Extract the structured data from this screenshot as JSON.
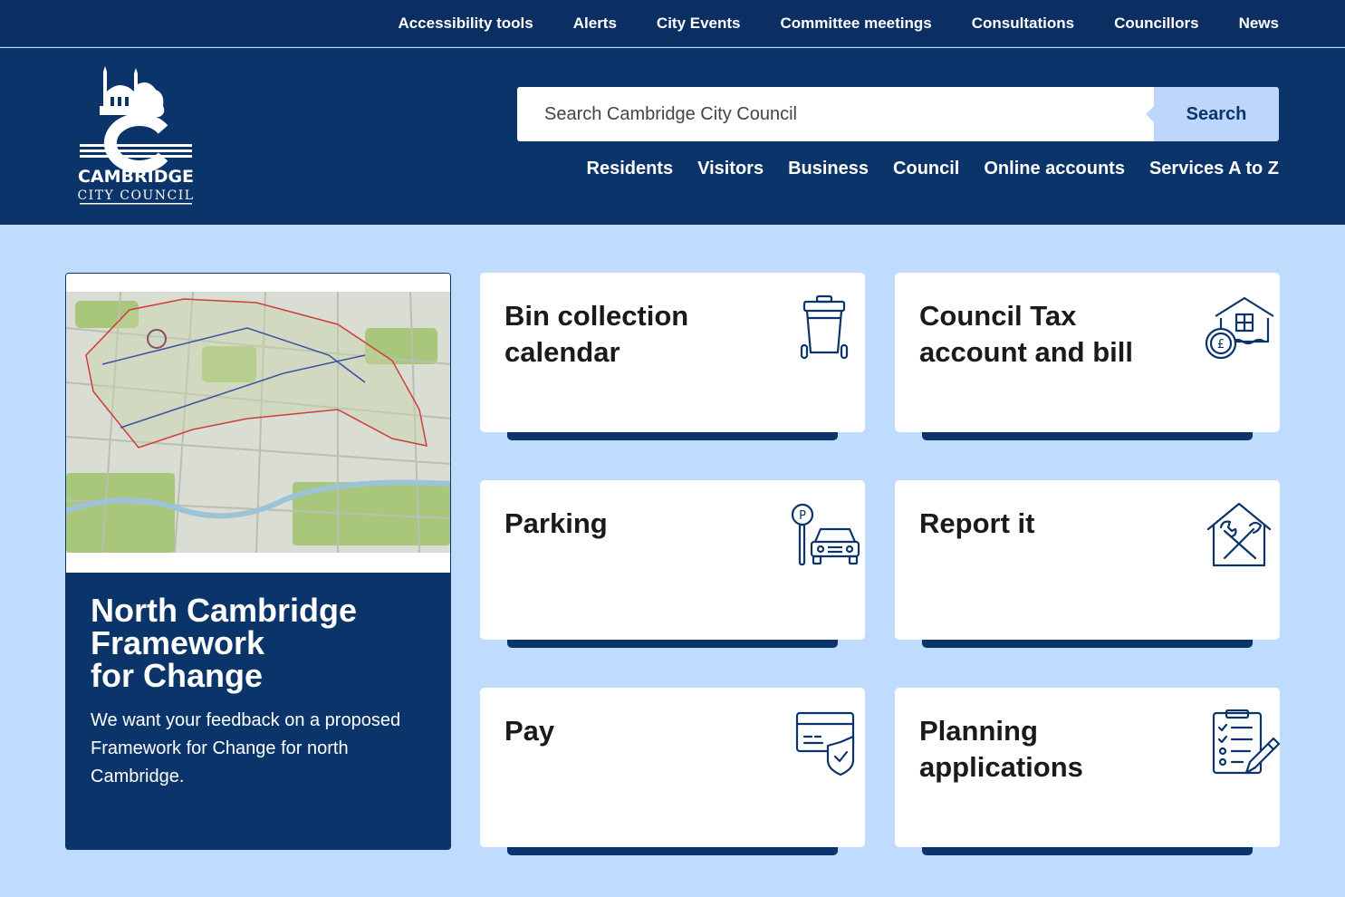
{
  "top_links": [
    "Accessibility tools",
    "Alerts",
    "City Events",
    "Committee meetings",
    "Consultations",
    "Councillors",
    "News"
  ],
  "logo": {
    "line1": "CAMBRIDGE",
    "line2": "CITY COUNCIL"
  },
  "search": {
    "placeholder": "Search Cambridge City Council",
    "button_label": "Search"
  },
  "main_nav": [
    "Residents",
    "Visitors",
    "Business",
    "Council",
    "Online accounts",
    "Services A to Z"
  ],
  "feature": {
    "title_lines": [
      "North Cambridge",
      "Framework",
      "for Change"
    ],
    "description": "We want your feedback on a proposed Framework for Change for north Cambridge."
  },
  "tiles": [
    {
      "title": "Bin collection calendar",
      "icon": "wheelie-bin-icon"
    },
    {
      "title": "Council Tax account and bill",
      "icon": "house-pound-icon"
    },
    {
      "title": "Parking",
      "icon": "parking-car-icon"
    },
    {
      "title": "Report it",
      "icon": "house-tools-icon"
    },
    {
      "title": "Pay",
      "icon": "card-shield-icon"
    },
    {
      "title": "Planning applications",
      "icon": "checklist-pencil-icon"
    }
  ],
  "colors": {
    "navy": "#0a346a",
    "top_bar": "#0b2e63",
    "page_bg": "#bfdbfe",
    "search_button": "#bcd7fb"
  }
}
